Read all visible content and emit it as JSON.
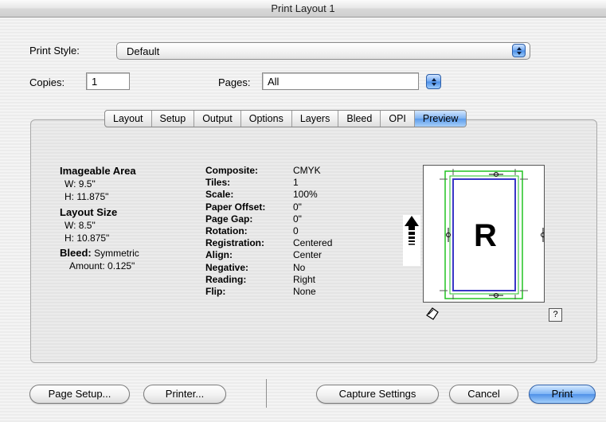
{
  "window": {
    "title": "Print Layout 1"
  },
  "print_style": {
    "label": "Print Style:",
    "value": "Default"
  },
  "copies": {
    "label": "Copies:",
    "value": "1"
  },
  "pages": {
    "label": "Pages:",
    "value": "All"
  },
  "tabs": [
    {
      "label": "Layout",
      "active": false
    },
    {
      "label": "Setup",
      "active": false
    },
    {
      "label": "Output",
      "active": false
    },
    {
      "label": "Options",
      "active": false
    },
    {
      "label": "Layers",
      "active": false
    },
    {
      "label": "Bleed",
      "active": false
    },
    {
      "label": "OPI",
      "active": false
    },
    {
      "label": "Preview",
      "active": true
    }
  ],
  "imageable_area": {
    "heading": "Imageable Area",
    "w": "W: 9.5\"",
    "h": "H: 11.875\""
  },
  "layout_size": {
    "heading": "Layout Size",
    "w": "W: 8.5\"",
    "h": "H: 10.875\""
  },
  "bleed": {
    "label": "Bleed:",
    "value": "Symmetric",
    "amount": "Amount: 0.125\""
  },
  "settings": [
    {
      "key": "Composite:",
      "value": "CMYK"
    },
    {
      "key": "Tiles:",
      "value": "1"
    },
    {
      "key": "Scale:",
      "value": "100%"
    },
    {
      "key": "Paper Offset:",
      "value": "0\""
    },
    {
      "key": "Page Gap:",
      "value": "0\""
    },
    {
      "key": "Rotation:",
      "value": "0"
    },
    {
      "key": "Registration:",
      "value": "Centered"
    },
    {
      "key": "Align:",
      "value": "Center"
    },
    {
      "key": "Negative:",
      "value": "No"
    },
    {
      "key": "Reading:",
      "value": "Right"
    },
    {
      "key": "Flip:",
      "value": "None"
    }
  ],
  "preview": {
    "letter": "R",
    "help": "?"
  },
  "buttons": {
    "page_setup": "Page Setup...",
    "printer": "Printer...",
    "capture": "Capture Settings",
    "cancel": "Cancel",
    "print": "Print"
  },
  "colors": {
    "accent_blue": "#5b9beb",
    "bleed_green": "#22c322",
    "page_blue": "#3a36c7"
  }
}
